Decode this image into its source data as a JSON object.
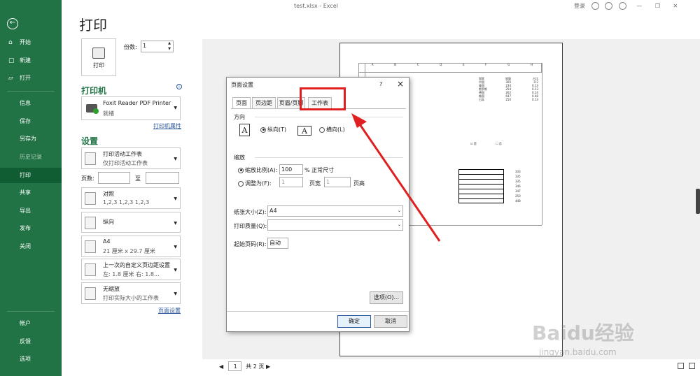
{
  "window": {
    "title": "test.xlsx - Excel",
    "login": "登录"
  },
  "nav": {
    "items": [
      "开始",
      "新建",
      "打开",
      "信息",
      "保存",
      "另存为",
      "历史记录",
      "打印",
      "共享",
      "导出",
      "发布",
      "关闭",
      "帐户",
      "反馈",
      "选项"
    ]
  },
  "print": {
    "title": "打印",
    "button_label": "打印",
    "copies_label": "份数:",
    "copies_value": "1",
    "printer_section": "打印机",
    "printer_name": "Foxit Reader PDF Printer",
    "printer_status": "就绪",
    "printer_props_link": "打印机属性",
    "settings_section": "设置",
    "pages_label": "页数:",
    "pages_to": "至",
    "settings": [
      {
        "l1": "打印活动工作表",
        "l2": "仅打印活动工作表"
      },
      {
        "l1": "对照",
        "l2": "1,2,3    1,2,3    1,2,3"
      },
      {
        "l1": "纵向",
        "l2": ""
      },
      {
        "l1": "A4",
        "l2": "21 厘米 x 29.7 厘米"
      },
      {
        "l1": "上一次的自定义页边距设置",
        "l2": "左: 1.8 厘米    右: 1.8..."
      },
      {
        "l1": "无缩放",
        "l2": "打印实际大小的工作表"
      }
    ],
    "page_setup_link": "页面设置"
  },
  "pager": {
    "current": "1",
    "total": "共 2 页"
  },
  "dialog": {
    "title": "页面设置",
    "help": "?",
    "close": "×",
    "tabs": [
      "页面",
      "页边距",
      "页眉/页脚",
      "工作表"
    ],
    "orientation_label": "方向",
    "portrait": "纵向(T)",
    "landscape": "横向(L)",
    "scaling_label": "缩放",
    "scale_ratio": "缩放比例(A):",
    "scale_value": "100",
    "scale_unit": "% 正常尺寸",
    "fit_to": "调整为(F):",
    "fit_w": "1",
    "fit_w_unit": "页宽",
    "fit_h": "1",
    "fit_h_unit": "页高",
    "paper_size_label": "纸张大小(Z):",
    "paper_size": "A4",
    "print_quality_label": "打印质量(Q):",
    "print_quality": "",
    "first_page_label": "起始页码(R):",
    "first_page": "自动",
    "options_btn": "选项(O)...",
    "ok_btn": "确定",
    "cancel_btn": "取消"
  },
  "preview": {
    "col_headers": [
      "A",
      "B",
      "C",
      "D",
      "E",
      "F",
      "G",
      "H"
    ],
    "headers": [
      "国家",
      "销量",
      "占比"
    ],
    "countries": [
      "中国",
      "美国",
      "俄罗斯",
      "德国",
      "韩国",
      "日本"
    ],
    "sales": [
      "300",
      "234",
      "254",
      "262",
      "647",
      "250"
    ],
    "pcts": [
      "0.2",
      "0.13",
      "0.13",
      "0.14",
      "0.48",
      "0.13"
    ],
    "check1": "是",
    "check2": "否",
    "col_values": [
      "333",
      "335",
      "335",
      "346",
      "347",
      "250",
      "448"
    ]
  },
  "watermark": {
    "brand": "Baidu经验",
    "url": "jingyan.baidu.com"
  }
}
